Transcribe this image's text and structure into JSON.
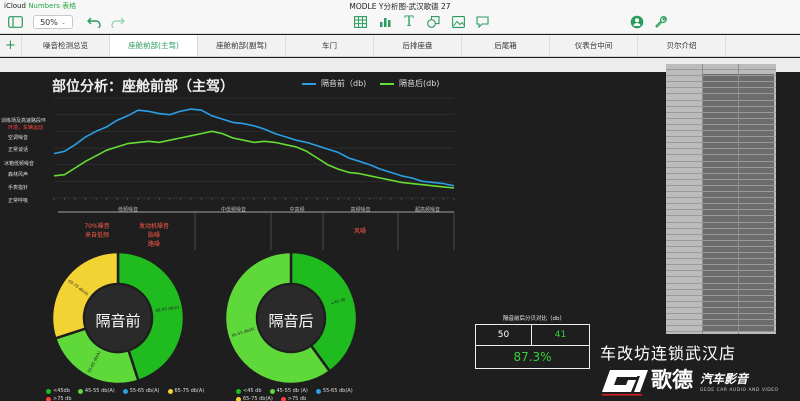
{
  "titlebar": {
    "icloud": "iCloud",
    "numbers": "Numbers 表格",
    "doc_title": "MODLE Y分析图-武汉歌德 27"
  },
  "toolbar": {
    "zoom": "50%",
    "icons": [
      "sidebar-icon",
      "undo-icon",
      "redo-icon",
      "table-icon",
      "chart-icon",
      "text-icon",
      "shape-icon",
      "media-icon",
      "comment-icon",
      "collaborate-icon",
      "settings-icon"
    ]
  },
  "tabs": [
    "噪音检测总览",
    "座舱前部(主驾)",
    "座舱前部(副驾)",
    "车门",
    "后排座盘",
    "后尾箱",
    "仪表台中间",
    "贝尔介绍"
  ],
  "active_tab": 1,
  "chart": {
    "title": "部位分析：座舱前部（主驾）",
    "legend": [
      {
        "name": "隔音前（db)",
        "color": "#2a9fe6"
      },
      {
        "name": "隔音后(db)",
        "color": "#66dd33"
      }
    ],
    "left_labels": [
      {
        "text": "训练场及高速路段环",
        "red": false
      },
      {
        "text": "环境，车辆运动",
        "red": true
      },
      {
        "text": "空调噪音",
        "red": false
      },
      {
        "text": "正常谈话",
        "red": false
      },
      {
        "text": "冰箱低频噪音",
        "red": false
      },
      {
        "text": "森林风声",
        "red": false
      },
      {
        "text": "手表指针",
        "red": false
      },
      {
        "text": "正常呼吸",
        "red": false
      }
    ],
    "region_labels": [
      "低频噪音",
      "中低频噪音",
      "中高频",
      "高频噪音",
      "超高频噪音"
    ],
    "annotations": [
      {
        "text": "70%噪音\n来自低频"
      },
      {
        "text": "发动机噪音\n胎噪\n路噪"
      },
      {
        "text": "风噪"
      }
    ]
  },
  "chart_data": [
    {
      "type": "line",
      "series": [
        {
          "name": "隔音前（db)",
          "values": [
            60,
            62,
            68,
            75,
            80,
            84,
            90,
            94,
            99,
            98,
            96,
            95,
            98,
            100,
            99,
            94,
            91,
            88,
            87,
            85,
            82,
            78,
            75,
            72,
            70,
            67,
            64,
            61,
            56,
            53,
            50,
            46,
            43,
            40,
            38,
            35,
            34,
            33,
            31
          ]
        },
        {
          "name": "隔音后(db)",
          "values": [
            40,
            41,
            47,
            53,
            58,
            63,
            66,
            69,
            70,
            71,
            70,
            72,
            74,
            76,
            78,
            80,
            78,
            74,
            72,
            70,
            71,
            70,
            68,
            66,
            62,
            56,
            50,
            46,
            43,
            42,
            40,
            38,
            36,
            34,
            33,
            32,
            31,
            30,
            29
          ]
        }
      ],
      "ylim": [
        20,
        110
      ]
    },
    {
      "type": "pie",
      "title": "隔音前",
      "slices": [
        {
          "label": "45-55 db(A)",
          "value": 45,
          "color": "#1fbb1f"
        },
        {
          "label": "55-65 db(A)",
          "value": 25,
          "color": "#5fd83a"
        },
        {
          "label": "65-75 db(A)",
          "value": 30,
          "color": "#f3d233"
        }
      ]
    },
    {
      "type": "pie",
      "title": "隔音后",
      "slices": [
        {
          "label": "<45 db",
          "value": 40,
          "color": "#1fbb1f"
        },
        {
          "label": "45-55 db(A)",
          "value": 60,
          "color": "#5fd83a"
        }
      ]
    }
  ],
  "pie1_legend": [
    {
      "text": "<45db",
      "color": "#1fbb1f"
    },
    {
      "text": "45-55 db(A)",
      "color": "#5fd83a"
    },
    {
      "text": "55-65 db(A)",
      "color": "#2a9fe6"
    },
    {
      "text": "65-75 db(A)",
      "color": "#f3d233"
    },
    {
      "text": ">75 db",
      "color": "#ff4040"
    }
  ],
  "pie2_legend": [
    {
      "text": "<45 db",
      "color": "#1fbb1f"
    },
    {
      "text": "45-55 db (A)",
      "color": "#5fd83a"
    },
    {
      "text": "55-65 db(A)",
      "color": "#2a9fe6"
    },
    {
      "text": "65-75 db(A)",
      "color": "#f3d233"
    },
    {
      "text": ">75 db",
      "color": "#ff4040"
    }
  ],
  "comparison": {
    "title": "隔音前后分贝对比（db）",
    "before": "50",
    "after": "41",
    "ratio": "87.3%"
  },
  "store": "车改坊连锁武汉店",
  "logo": {
    "brand": "歌德",
    "slogan": "汽车影音",
    "english": "GEDE CAR AUDIO AND VIDEO"
  },
  "colors": {
    "accent": "#2a9d5c",
    "before_line": "#2a9fe6",
    "after_line": "#66dd33"
  }
}
